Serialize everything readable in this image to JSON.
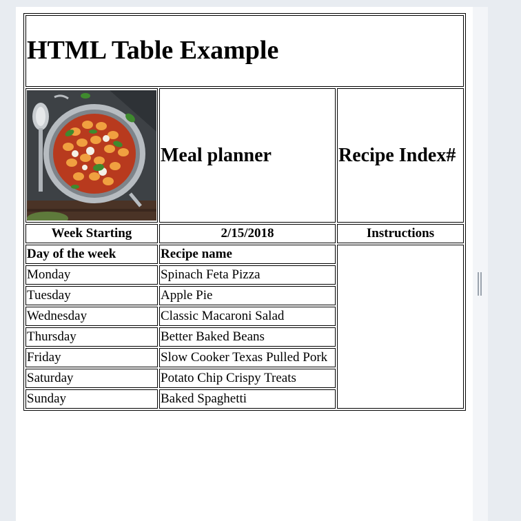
{
  "page": {
    "title": "HTML Table Example"
  },
  "header": {
    "image": {
      "alt": "Pan of gnocchi with tomato sauce, basil and mozzarella",
      "icon": "food-photo"
    },
    "meal_planner": "Meal planner",
    "recipe_index": "Recipe Index#"
  },
  "week_row": {
    "week_starting_label": "Week Starting",
    "date": "2/15/2018",
    "instructions_label": "Instructions"
  },
  "table": {
    "columns": [
      "Day of the week",
      "Recipe name"
    ],
    "rows": [
      {
        "day": "Monday",
        "recipe": "Spinach Feta Pizza"
      },
      {
        "day": "Tuesday",
        "recipe": "Apple Pie"
      },
      {
        "day": "Wednesday",
        "recipe": "Classic Macaroni Salad"
      },
      {
        "day": "Thursday",
        "recipe": "Better Baked Beans"
      },
      {
        "day": "Friday",
        "recipe": "Slow Cooker Texas Pulled Pork"
      },
      {
        "day": "Saturday",
        "recipe": "Potato Chip Crispy Treats"
      },
      {
        "day": "Sunday",
        "recipe": "Baked Spaghetti"
      }
    ]
  },
  "colors": {
    "background": "#e8ecf1",
    "page": "#ffffff",
    "border": "#000000"
  }
}
